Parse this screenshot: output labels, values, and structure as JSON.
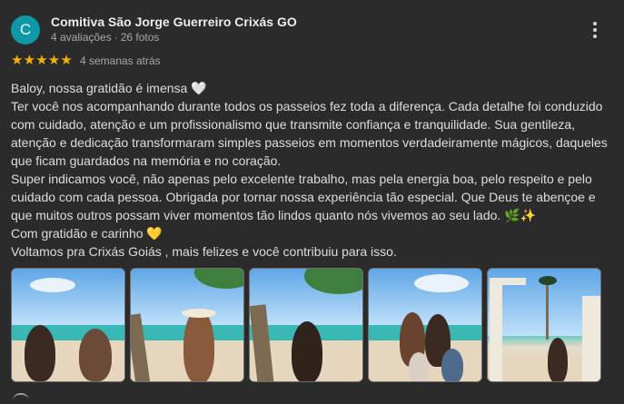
{
  "reviewer": {
    "initial": "C",
    "name": "Comitiva São Jorge Guerreiro Crixás GO",
    "reviews_count": "4 avaliações",
    "separator": "·",
    "photos_count": "26 fotos"
  },
  "rating": {
    "stars": 5,
    "star_glyph": "★",
    "time": "4 semanas atrás",
    "color": "#f5b301"
  },
  "review": {
    "lines": [
      "Baloy, nossa gratidão é imensa 🤍",
      "Ter você nos acompanhando durante todos os passeios fez toda a diferença. Cada detalhe foi conduzido",
      "com cuidado, atenção e um profissionalismo que transmite confiança e tranquilidade. Sua gentileza,",
      "atenção e dedicação transformaram simples passeios em momentos verdadeiramente mágicos, daqueles",
      "que ficam guardados na memória e no coração.",
      "Super indicamos você, não apenas pelo excelente trabalho, mas pela energia boa, pelo respeito e pelo",
      "cuidado com cada pessoa. Obrigada por tornar nossa experiência tão especial. Que Deus te abençoe e",
      "que muitos outros possam viver momentos tão lindos quanto nós vivemos ao seu lado. 🌿✨",
      "Com gratidão e carinho 💛",
      "Voltamos pra Crixás Goiás , mais felizes e você contribuiu para isso."
    ]
  },
  "photos": [
    {
      "name": "photo-1"
    },
    {
      "name": "photo-2"
    },
    {
      "name": "photo-3"
    },
    {
      "name": "photo-4"
    },
    {
      "name": "photo-5"
    }
  ],
  "icons": {
    "more": "more-vert-icon",
    "star": "star-icon"
  },
  "colors": {
    "background": "#2b2b2b",
    "avatar": "#0e98a8"
  }
}
